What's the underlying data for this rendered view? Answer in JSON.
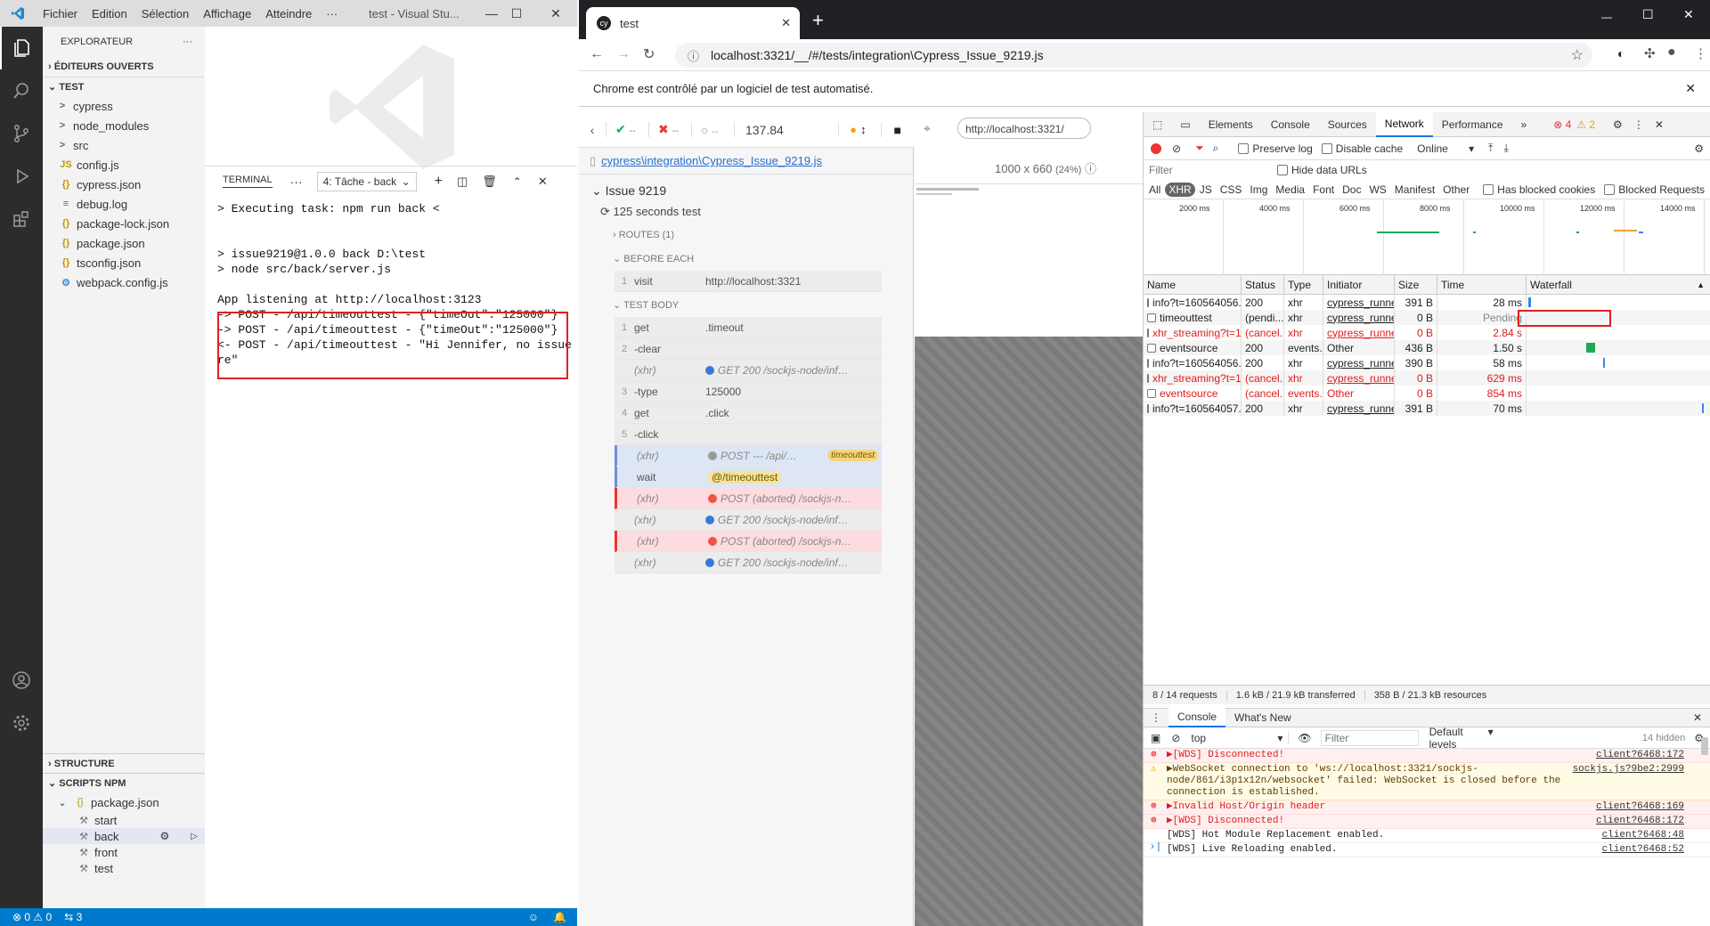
{
  "vscode": {
    "menu": [
      "Fichier",
      "Edition",
      "Sélection",
      "Affichage",
      "Atteindre",
      "···"
    ],
    "window_title": "test - Visual Stu...",
    "explorer_title": "EXPLORATEUR",
    "open_editors": "ÉDITEURS OUVERTS",
    "folder": "TEST",
    "tree": [
      {
        "icon": ">",
        "label": "cypress",
        "kind": "folder"
      },
      {
        "icon": ">",
        "label": "node_modules",
        "kind": "folder"
      },
      {
        "icon": ">",
        "label": "src",
        "kind": "folder"
      },
      {
        "icon": "JS",
        "label": "config.js",
        "kind": "js"
      },
      {
        "icon": "{}",
        "label": "cypress.json",
        "kind": "json"
      },
      {
        "icon": "≡",
        "label": "debug.log",
        "kind": "log"
      },
      {
        "icon": "{}",
        "label": "package-lock.json",
        "kind": "json"
      },
      {
        "icon": "{}",
        "label": "package.json",
        "kind": "json"
      },
      {
        "icon": "{}",
        "label": "tsconfig.json",
        "kind": "json"
      },
      {
        "icon": "⚙",
        "label": "webpack.config.js",
        "kind": "webpack"
      }
    ],
    "structure": "STRUCTURE",
    "npm_scripts": "SCRIPTS NPM",
    "npm_pkg": "package.json",
    "npm_items": [
      "start",
      "back",
      "front",
      "test"
    ],
    "terminal_tab": "TERMINAL",
    "terminal_select": "4: Tâche - back",
    "terminal_lines": [
      "> Executing task: npm run back <",
      "",
      "",
      "> issue9219@1.0.0 back D:\\test",
      "> node src/back/server.js",
      "",
      "App listening at http://localhost:3123",
      "-> POST - /api/timeouttest - {\"timeOut\":\"125000\"}",
      "-> POST - /api/timeouttest - {\"timeOut\":\"125000\"}",
      "<- POST - /api/timeouttest - \"Hi Jennifer, no issue he",
      "re\""
    ],
    "status": {
      "errors": "0",
      "warnings": "0",
      "ports": "3"
    }
  },
  "chrome": {
    "tab_title": "test",
    "url": "localhost:3321/__/#/tests/integration\\Cypress_Issue_9219.js",
    "infobar": "Chrome est contrôlé par un logiciel de test automatisé.",
    "cypress": {
      "passed": "--",
      "failed": "--",
      "pending": "--",
      "duration": "137.84",
      "aut_url": "http://localhost:3321/",
      "viewport": "1000 x 660",
      "scale": "(24%)",
      "spec": "cypress\\integration\\Cypress_Issue_9219.js",
      "suite": "Issue 9219",
      "test": "125 seconds test",
      "routes": "ROUTES (1)",
      "before_each": "BEFORE EACH",
      "test_body": "TEST BODY",
      "before_cmds": [
        {
          "n": "1",
          "name": "visit",
          "msg": "http://localhost:3321"
        }
      ],
      "body_cmds": [
        {
          "n": "1",
          "name": "get",
          "msg": ".timeout",
          "style": "",
          "dot": ""
        },
        {
          "n": "2",
          "name": "-clear",
          "msg": "",
          "style": "",
          "dot": ""
        },
        {
          "n": "",
          "name": "(xhr)",
          "msg": "GET 200 /sockjs-node/inf…",
          "style": "it",
          "dot": "#3c78d8"
        },
        {
          "n": "3",
          "name": "-type",
          "msg": "125000",
          "style": "",
          "dot": ""
        },
        {
          "n": "4",
          "name": "get",
          "msg": ".click",
          "style": "",
          "dot": ""
        },
        {
          "n": "5",
          "name": "-click",
          "msg": "",
          "style": "",
          "dot": ""
        },
        {
          "n": "",
          "name": "(xhr)",
          "msg": "POST --- /api/…",
          "style": "it pend",
          "dot": "#999",
          "alias": "timeouttest"
        },
        {
          "n": "",
          "name": "wait",
          "msg": "@/timeouttest",
          "style": "pend",
          "dot": "",
          "alias": ""
        },
        {
          "n": "",
          "name": "(xhr)",
          "msg": "POST (aborted) /sockjs-n…",
          "style": "it fail",
          "dot": "#e54"
        },
        {
          "n": "",
          "name": "(xhr)",
          "msg": "GET 200 /sockjs-node/inf…",
          "style": "it",
          "dot": "#3c78d8"
        },
        {
          "n": "",
          "name": "(xhr)",
          "msg": "POST (aborted) /sockjs-n…",
          "style": "it fail",
          "dot": "#e54"
        },
        {
          "n": "",
          "name": "(xhr)",
          "msg": "GET 200 /sockjs-node/inf…",
          "style": "it",
          "dot": "#3c78d8"
        }
      ]
    },
    "devtools": {
      "tabs": [
        "Elements",
        "Console",
        "Sources",
        "Network",
        "Performance"
      ],
      "errors": "4",
      "warnings": "2",
      "preserve_log": "Preserve log",
      "disable_cache": "Disable cache",
      "throttle": "Online",
      "filter_placeholder": "Filter",
      "hide_data_urls": "Hide data URLs",
      "types": [
        "All",
        "XHR",
        "JS",
        "CSS",
        "Img",
        "Media",
        "Font",
        "Doc",
        "WS",
        "Manifest",
        "Other"
      ],
      "has_blocked": "Has blocked cookies",
      "blocked_req": "Blocked Requests",
      "timeline_ticks": [
        "2000 ms",
        "4000 ms",
        "6000 ms",
        "8000 ms",
        "10000 ms",
        "12000 ms",
        "14000 ms"
      ],
      "columns": [
        "Name",
        "Status",
        "Type",
        "Initiator",
        "Size",
        "Time",
        "Waterfall"
      ],
      "rows": [
        {
          "name": "info?t=160564056...",
          "status": "200",
          "type": "xhr",
          "init": "cypress_runne...",
          "size": "391 B",
          "time": "28 ms",
          "red": false
        },
        {
          "name": "timeouttest",
          "status": "(pendi...",
          "type": "xhr",
          "init": "cypress_runne...",
          "size": "0 B",
          "time": "Pending",
          "red": false
        },
        {
          "name": "xhr_streaming?t=1...",
          "status": "(cancel...",
          "type": "xhr",
          "init": "cypress_runne...",
          "size": "0 B",
          "time": "2.84 s",
          "red": true
        },
        {
          "name": "eventsource",
          "status": "200",
          "type": "events...",
          "init": "Other",
          "size": "436 B",
          "time": "1.50 s",
          "red": false
        },
        {
          "name": "info?t=160564056...",
          "status": "200",
          "type": "xhr",
          "init": "cypress_runne...",
          "size": "390 B",
          "time": "58 ms",
          "red": false
        },
        {
          "name": "xhr_streaming?t=1...",
          "status": "(cancel...",
          "type": "xhr",
          "init": "cypress_runne...",
          "size": "0 B",
          "time": "629 ms",
          "red": true
        },
        {
          "name": "eventsource",
          "status": "(cancel...",
          "type": "events...",
          "init": "Other",
          "size": "0 B",
          "time": "854 ms",
          "red": true
        },
        {
          "name": "info?t=160564057...",
          "status": "200",
          "type": "xhr",
          "init": "cypress_runne...",
          "size": "391 B",
          "time": "70 ms",
          "red": false
        }
      ],
      "summary": [
        "8 / 14 requests",
        "1.6 kB / 21.9 kB transferred",
        "358 B / 21.3 kB resources"
      ],
      "drawer_tabs": [
        "Console",
        "What's New"
      ],
      "context": "top",
      "console_filter": "Filter",
      "levels": "Default levels",
      "hidden": "14 hidden",
      "console": [
        {
          "kind": "err",
          "text": "▶[WDS] Disconnected!",
          "src": "client?6468:172"
        },
        {
          "kind": "warn",
          "text": "▶WebSocket connection to 'ws://localhost:3321/sockjs-node/861/i3p1x12n/websocket' failed: WebSocket is closed before the connection is established.",
          "src": "sockjs.js?9be2:2999"
        },
        {
          "kind": "err",
          "text": "▶Invalid Host/Origin header",
          "src": "client?6468:169"
        },
        {
          "kind": "err",
          "text": "▶[WDS] Disconnected!",
          "src": "client?6468:172"
        },
        {
          "kind": "info",
          "text": "[WDS] Hot Module Replacement enabled.",
          "src": "client?6468:48"
        },
        {
          "kind": "info",
          "text": "[WDS] Live Reloading enabled.",
          "src": "client?6468:52"
        }
      ]
    }
  }
}
